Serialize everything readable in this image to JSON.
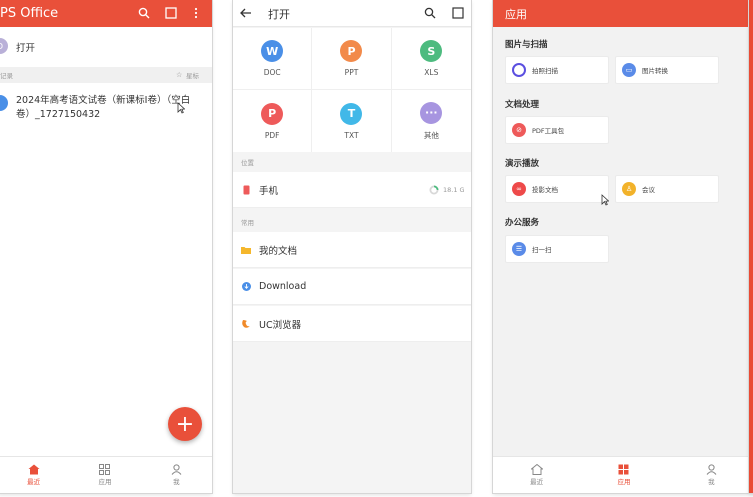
{
  "screen1": {
    "app_title": "PS Office",
    "open_label": "打开",
    "open_avatar_letter": "D",
    "section_label": "记录",
    "section_right": "星标",
    "doc_title_line1": "2024年高考语文试卷（新课标Ⅰ卷）（空白",
    "doc_title_line2": "卷）_1727150432",
    "fab_label": "+",
    "tabs": [
      {
        "label": "最近",
        "icon": "home-icon",
        "active": true
      },
      {
        "label": "应用",
        "icon": "apps-grid-icon",
        "active": false
      },
      {
        "label": "我",
        "icon": "person-icon",
        "active": false
      }
    ]
  },
  "screen2": {
    "title": "打开",
    "filetypes": [
      {
        "label": "DOC",
        "glyph": "W",
        "color": "#4a8fe7"
      },
      {
        "label": "PPT",
        "glyph": "P",
        "color": "#f28a4a"
      },
      {
        "label": "XLS",
        "glyph": "S",
        "color": "#4dbb7f"
      },
      {
        "label": "PDF",
        "glyph": "P",
        "color": "#ee5a5a"
      },
      {
        "label": "TXT",
        "glyph": "T",
        "color": "#41b8e8"
      },
      {
        "label": "其他",
        "glyph": "···",
        "color": "#a795e0"
      }
    ],
    "location_header": "位置",
    "phone_label": "手机",
    "phone_storage": "18.1 G",
    "common_header": "常用",
    "common": [
      {
        "label": "我的文档",
        "icon": "folder-icon",
        "color": "#f5b72c"
      },
      {
        "label": "Download",
        "icon": "download-icon",
        "color": "#4a8fe7"
      },
      {
        "label": "UC浏览器",
        "icon": "uc-browser-icon",
        "color": "#f08a2a"
      }
    ]
  },
  "screen3": {
    "title": "应用",
    "sections": [
      {
        "title": "图片与扫描",
        "items": [
          {
            "label": "拍照扫描",
            "color": "#5b4fe0"
          },
          {
            "label": "图片转换",
            "color": "#5a8be8"
          }
        ]
      },
      {
        "title": "文档处理",
        "items": [
          {
            "label": "PDF工具包",
            "color": "#ee5a5a"
          }
        ]
      },
      {
        "title": "演示播放",
        "items": [
          {
            "label": "投影文档",
            "color": "#ee4a4a"
          },
          {
            "label": "会议",
            "color": "#f2b22a"
          }
        ]
      },
      {
        "title": "办公服务",
        "items": [
          {
            "label": "扫一扫",
            "color": "#5a8be8"
          }
        ]
      }
    ],
    "tabs": [
      {
        "label": "最近",
        "icon": "home-icon",
        "active": false
      },
      {
        "label": "应用",
        "icon": "apps-grid-icon",
        "active": true
      },
      {
        "label": "我",
        "icon": "person-icon",
        "active": false
      }
    ]
  }
}
